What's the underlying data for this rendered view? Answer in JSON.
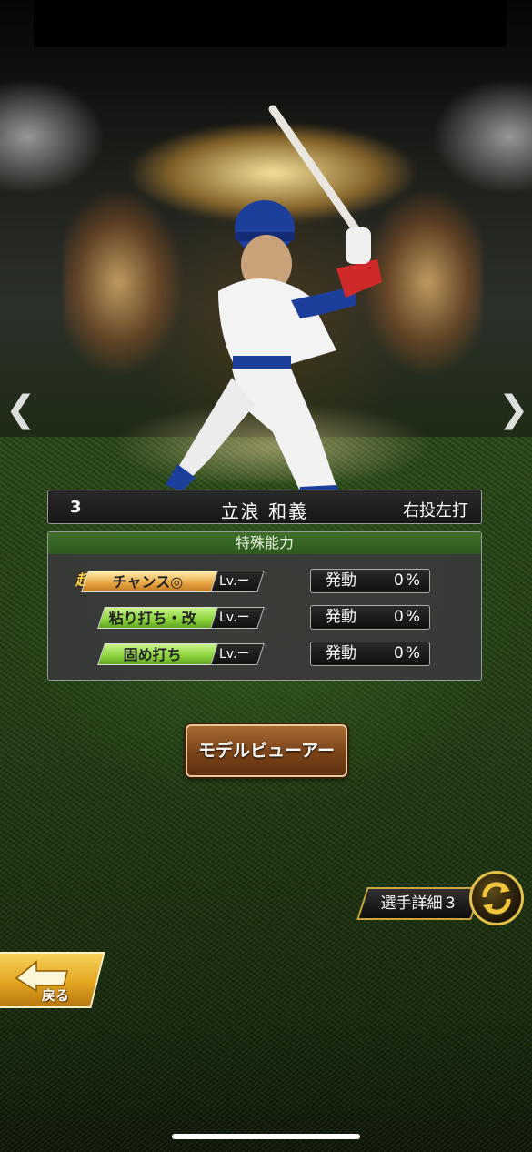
{
  "player": {
    "number": "3",
    "name": "立浪 和義",
    "handedness": "右投左打"
  },
  "abilities": {
    "header": "特殊能力",
    "items": [
      {
        "prefix": "超",
        "name": "チャンス◎",
        "level": "Lv.ー",
        "trigger_label": "発動",
        "trigger_value": "0%",
        "tier": "gold"
      },
      {
        "prefix": "",
        "name": "粘り打ち・改",
        "level": "Lv.ー",
        "trigger_label": "発動",
        "trigger_value": "0%",
        "tier": "green"
      },
      {
        "prefix": "",
        "name": "固め打ち",
        "level": "Lv.ー",
        "trigger_label": "発動",
        "trigger_value": "0%",
        "tier": "green"
      }
    ]
  },
  "buttons": {
    "model_viewer": "モデルビューアー",
    "player_detail": "選手詳細３",
    "back": "戻る"
  },
  "nav": {
    "prev_glyph": "❮",
    "next_glyph": "❯"
  },
  "colors": {
    "gold_tag": "#e8a440",
    "green_tag": "#8ad13a",
    "header_green": "#2b5a1d",
    "model_button": "#7a4318",
    "back_button": "#e2a520"
  },
  "icons": [
    "chevron-left-icon",
    "chevron-right-icon",
    "switch-icon",
    "back-arrow-icon"
  ]
}
